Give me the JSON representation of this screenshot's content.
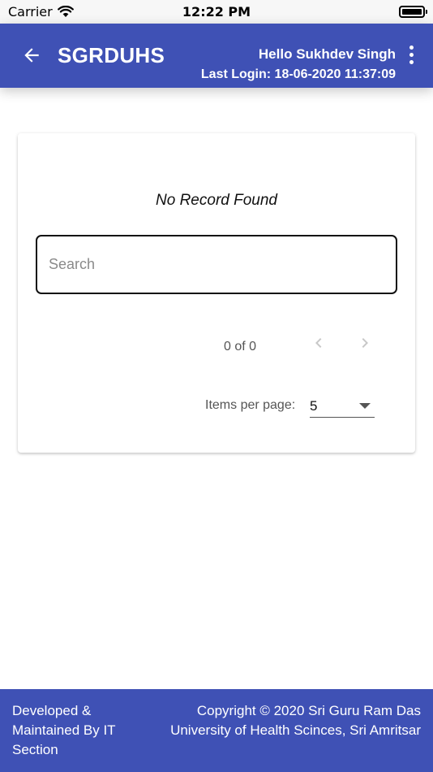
{
  "status_bar": {
    "carrier": "Carrier",
    "time": "12:22 PM"
  },
  "header": {
    "title": "SGRDUHS",
    "greeting": "Hello Sukhdev Singh",
    "last_login": "Last Login: 18-06-2020 11:37:09",
    "background_color": "#3f51b5"
  },
  "card": {
    "empty_message": "No Record Found",
    "search": {
      "value": "",
      "placeholder": "Search"
    },
    "paginator": {
      "range_label": "0 of 0",
      "items_per_page_label": "Items per page:",
      "page_size": "5"
    }
  },
  "footer": {
    "left_text": "Developed & Maintained By IT Section",
    "right_text": "Copyright © 2020 Sri Guru Ram Das University of Health Scinces, Sri Amritsar"
  }
}
